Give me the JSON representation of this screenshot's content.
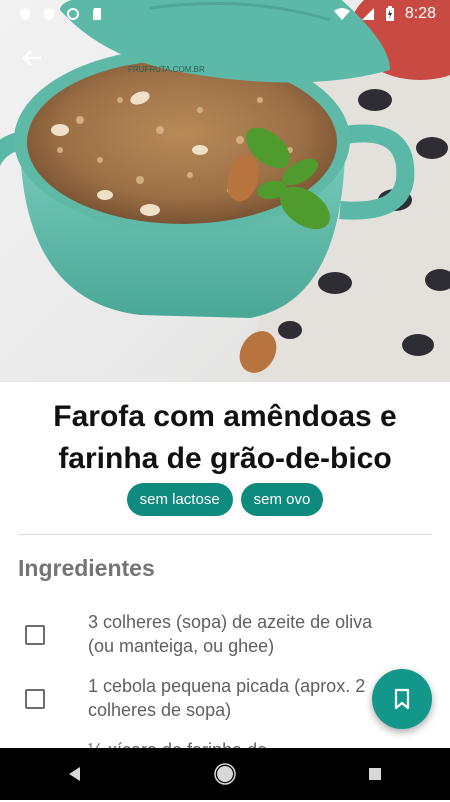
{
  "status_bar": {
    "time": "8:28",
    "icons": [
      "shield-icon",
      "shield-icon",
      "sync-icon",
      "sd-card-icon",
      "wifi-icon",
      "signal-icon",
      "battery-charging-icon"
    ]
  },
  "header": {
    "back_icon": "arrow-back-icon",
    "hero_watermark": "FRUFRUTA.COM.BR"
  },
  "recipe": {
    "title": "Farofa com amêndoas e farinha de grão-de-bico",
    "tags": [
      "sem lactose",
      "sem ovo"
    ]
  },
  "ingredients": {
    "heading": "Ingredientes",
    "items": [
      [
        "3 colheres (sopa) de azeite de oliva",
        "(ou manteiga, ou ghee)"
      ],
      [
        "1 cebola pequena picada (aprox. 2",
        "colheres de sopa)"
      ],
      [
        "½ xícara de farinha de",
        ""
      ]
    ]
  },
  "fab": {
    "icon": "bookmark-icon"
  },
  "nav": {
    "icons": [
      "back-triangle-icon",
      "home-circle-icon",
      "recents-square-icon"
    ]
  },
  "colors": {
    "accent": "#13978b",
    "chip": "#0f8a7e",
    "pot": "#6fc2b2"
  }
}
